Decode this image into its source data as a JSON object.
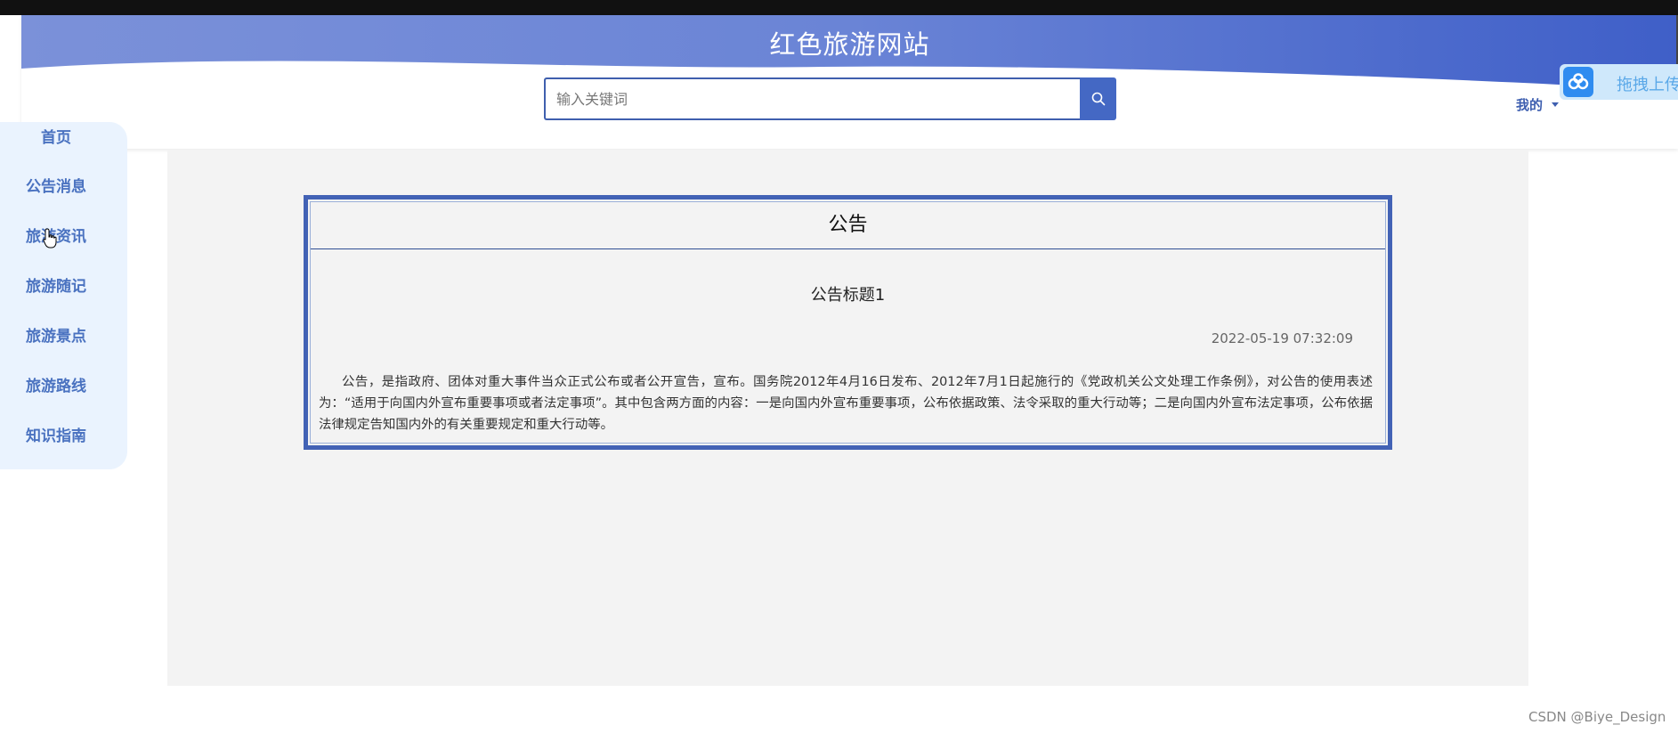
{
  "site": {
    "title": "红色旅游网站"
  },
  "search": {
    "placeholder": "输入关键词"
  },
  "user_menu": {
    "label": "我的"
  },
  "upload_widget": {
    "label": "拖拽上传"
  },
  "sidebar": {
    "items": [
      {
        "label": "首页"
      },
      {
        "label": "公告消息"
      },
      {
        "label": "旅游资讯"
      },
      {
        "label": "旅游随记"
      },
      {
        "label": "旅游景点"
      },
      {
        "label": "旅游路线"
      },
      {
        "label": "知识指南"
      }
    ]
  },
  "notice": {
    "heading": "公告",
    "title": "公告标题1",
    "time": "2022-05-19 07:32:09",
    "body": "公告，是指政府、团体对重大事件当众正式公布或者公开宣告，宣布。国务院2012年4月16日发布、2012年7月1日起施行的《党政机关公文处理工作条例》，对公告的使用表述为：“适用于向国内外宣布重要事项或者法定事项”。其中包含两方面的内容：一是向国内外宣布重要事项，公布依据政策、法令采取的重大行动等；二是向国内外宣布法定事项，公布依据法律规定告知国内外的有关重要规定和重大行动等。"
  },
  "watermark": "CSDN @Biye_Design",
  "colors": {
    "accent": "#4468c4",
    "header_gradient_start": "#7b91d9",
    "header_gradient_end": "#3f5fc8",
    "sidebar_bg": "#eaf3fe"
  },
  "icons": {
    "search": "search-icon",
    "caret": "caret-down-icon",
    "upload": "baidu-cloud-icon",
    "cursor": "hand-pointer-icon"
  }
}
